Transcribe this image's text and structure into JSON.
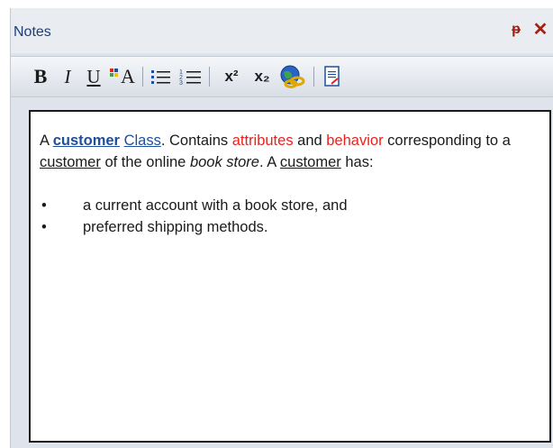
{
  "panel": {
    "title": "Notes",
    "pin_glyph": "ᵽ",
    "close_glyph": "✕"
  },
  "toolbar": {
    "bold": "B",
    "italic": "I",
    "underline": "U",
    "font_color": "A",
    "bullets_glyph": "☰",
    "numbering_glyph": "☰",
    "superscript": "x²",
    "subscript": "x₂"
  },
  "note": {
    "p1_a": "A ",
    "p1_customer": "customer",
    "p1_space": " ",
    "p1_class": "Class",
    "p1_b": ". Contains ",
    "p1_attributes": "attributes",
    "p1_c": " and ",
    "p1_behavior": "behavior",
    "p1_d": " corresponding to a ",
    "p1_customer2": "customer",
    "p1_e": " of the online ",
    "p1_bookstore": "book store",
    "p1_f": ". A ",
    "p1_customer3": "customer",
    "p1_g": " has:",
    "bullet_char": "•",
    "bullets": [
      "a current account with a book store, and",
      "preferred shipping methods."
    ]
  },
  "colors": {
    "title": "#1b3f77",
    "link": "#1f4e9c",
    "highlight": "#e8231e",
    "close": "#a4200f"
  }
}
